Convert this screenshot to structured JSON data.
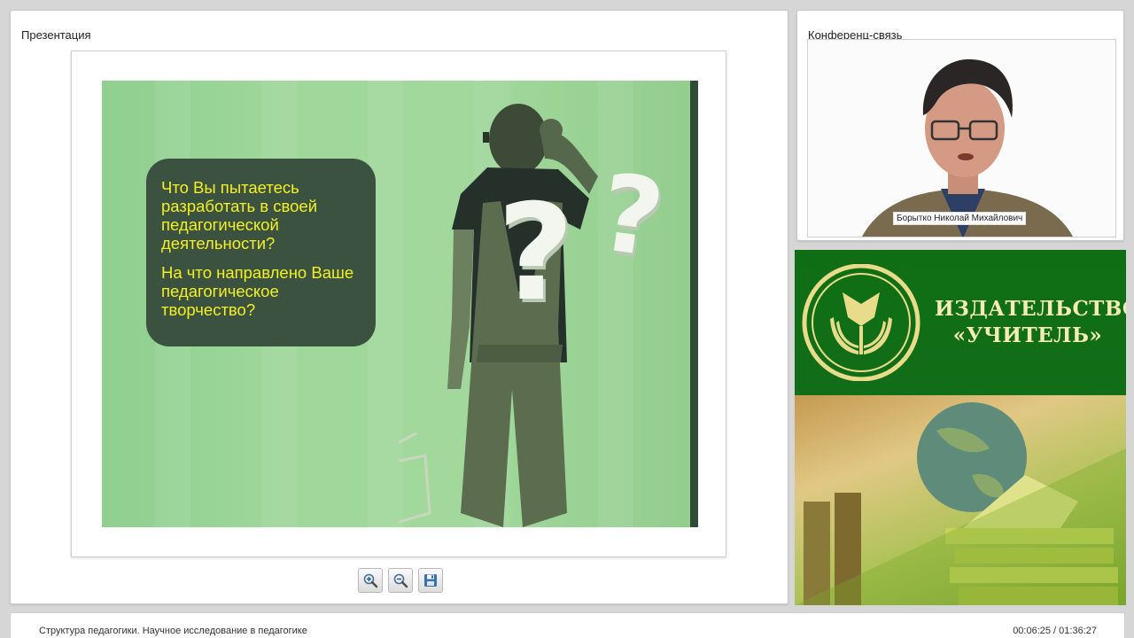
{
  "presentation": {
    "title": "Презентация",
    "slide": {
      "question_1": "Что Вы пытаетесь разработать в своей педагогической деятельности?",
      "question_2": "На что направлено Ваше педагогическое творчество?",
      "question_mark": "?"
    },
    "controls": {
      "zoom_in": "zoom-in-icon",
      "zoom_out": "zoom-out-icon",
      "save": "save-icon"
    }
  },
  "conference": {
    "title": "Конференц-связь",
    "speaker_name": "Борытко Николай Михайлович"
  },
  "publisher": {
    "name_line_1": "ИЗДАТЕЛЬСТВО",
    "name_line_2": "«УЧИТЕЛЬ»"
  },
  "footer": {
    "lecture_title": "Структура педагогики. Научное исследование в педагогике",
    "time": "00:06:25 / 01:36:27"
  },
  "colors": {
    "slide_green": "#9fd79a",
    "question_box": "#3c5240",
    "question_text": "#f3f021",
    "publisher_green": "#126d18",
    "publisher_text": "#f4ecb2"
  }
}
